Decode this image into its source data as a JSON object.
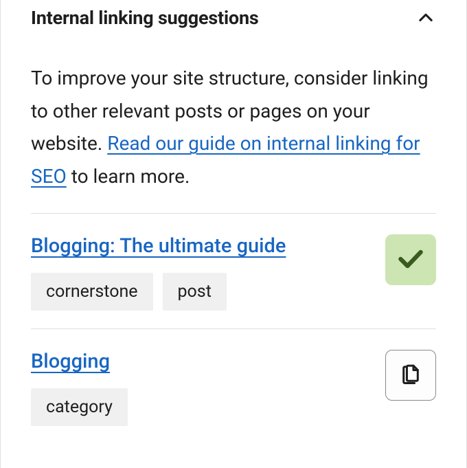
{
  "panel": {
    "title": "Internal linking suggestions",
    "expanded": true
  },
  "intro": {
    "prefix": "To improve your site structure, consider linking to other relevant posts or pages on your website. ",
    "link_text": "Read our guide on internal linking for SEO",
    "suffix": " to learn more."
  },
  "suggestions": [
    {
      "title": "Blogging: The ultimate guide",
      "tags": [
        "cornerstone",
        "post"
      ],
      "status": "done"
    },
    {
      "title": "Blogging",
      "tags": [
        "category"
      ],
      "status": "copy"
    }
  ]
}
